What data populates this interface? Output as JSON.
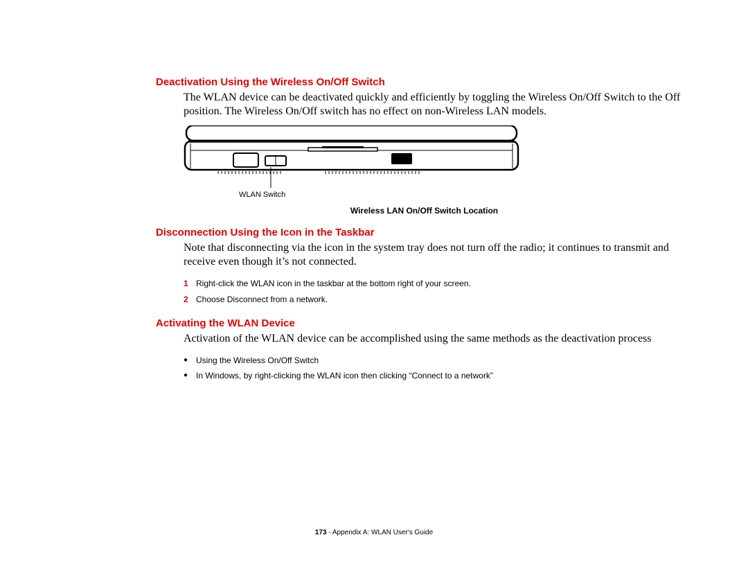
{
  "section1": {
    "heading": "Deactivation Using the Wireless On/Off Switch",
    "body": "The WLAN device can be deactivated quickly and efficiently by toggling the Wireless On/Off Switch to the Off position. The Wireless On/Off switch has no effect on non-Wireless LAN models."
  },
  "figure": {
    "callout": "WLAN Switch",
    "caption": "Wireless LAN On/Off Switch Location"
  },
  "section2": {
    "heading": "Disconnection Using the Icon in the Taskbar",
    "body": "Note that disconnecting via the icon in the system tray does not turn off the radio; it continues to transmit and receive even though it’s not connected.",
    "steps": [
      "Right-click the WLAN icon in the taskbar at the bottom right of your screen.",
      "Choose Disconnect from a network."
    ]
  },
  "section3": {
    "heading": "Activating the WLAN Device",
    "body": "Activation of the WLAN device can be accomplished using the same methods as the deactivation process",
    "bullets": [
      "Using the Wireless On/Off Switch",
      "In Windows, by right-clicking the WLAN icon then clicking “Connect to a network”"
    ]
  },
  "footer": {
    "page": "173",
    "sep": " - ",
    "title": "Appendix A: WLAN User's Guide"
  }
}
